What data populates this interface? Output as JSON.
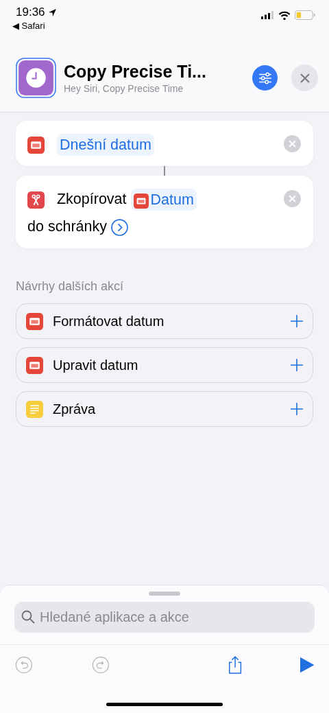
{
  "status_bar": {
    "time": "19:36",
    "back_app": "◀ Safari"
  },
  "header": {
    "title": "Copy Precise Ti...",
    "subtitle": "Hey Siri, Copy Precise Time"
  },
  "actions": [
    {
      "kind": "date",
      "parts": [
        {
          "kind": "token",
          "text": "Dnešní datum"
        }
      ]
    },
    {
      "kind": "clipboard",
      "parts": [
        {
          "kind": "text",
          "text": "Zkopírovat"
        },
        {
          "kind": "date_token",
          "text": "Datum"
        },
        {
          "kind": "text",
          "text": "do"
        },
        {
          "kind": "text",
          "text": "schránky"
        },
        {
          "kind": "more"
        }
      ]
    }
  ],
  "suggestions_heading": "Návrhy dalších akcí",
  "suggestions": [
    {
      "label": "Formátovat datum",
      "kind": "date"
    },
    {
      "label": "Upravit datum",
      "kind": "date"
    },
    {
      "label": "Zpráva",
      "kind": "text"
    }
  ],
  "search": {
    "placeholder": "Hledané aplikace a akce"
  },
  "toolbar": [
    {
      "kind": "undo",
      "disabled": true
    },
    {
      "kind": "redo",
      "disabled": true
    },
    {
      "kind": "share",
      "disabled": false
    },
    {
      "kind": "run",
      "disabled": false
    }
  ]
}
